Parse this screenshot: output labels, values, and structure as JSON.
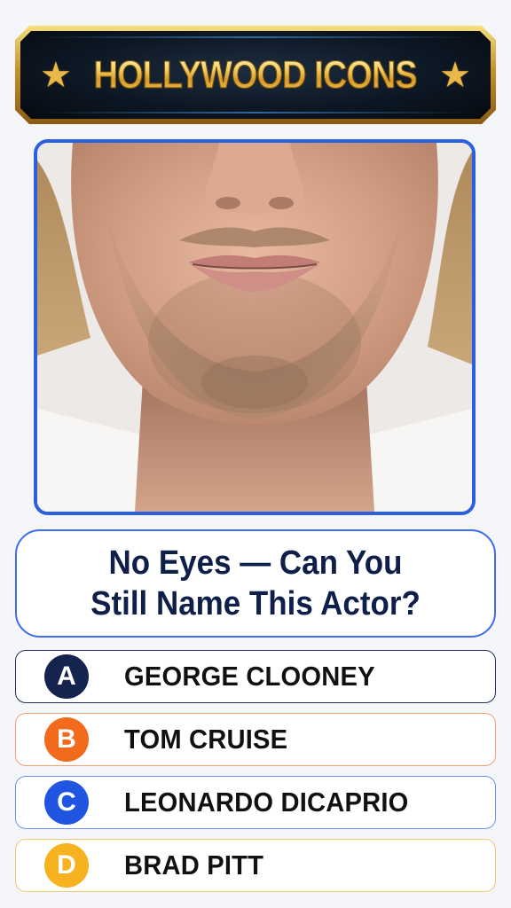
{
  "banner": {
    "title": "HOLLYWOOD ICONS",
    "left_icon": "star-icon",
    "right_icon": "star-icon",
    "colors": {
      "gold": "#d8a535",
      "background": "#0c1622",
      "glow": "#4fa8ff"
    }
  },
  "photo": {
    "subject": "actor-lower-face-photo",
    "frame_color": "#2b5fe0"
  },
  "question": {
    "text": "No Eyes — Can You\nStill Name This Actor?",
    "border_color": "#3e6df0"
  },
  "options": [
    {
      "letter": "A",
      "label": "GEORGE CLOONEY",
      "color": "#14244f"
    },
    {
      "letter": "B",
      "label": "TOM CRUISE",
      "color": "#f26a1b"
    },
    {
      "letter": "C",
      "label": "LEONARDO DICAPRIO",
      "color": "#1f55e0"
    },
    {
      "letter": "D",
      "label": "BRAD PITT",
      "color": "#f6b31f"
    }
  ]
}
